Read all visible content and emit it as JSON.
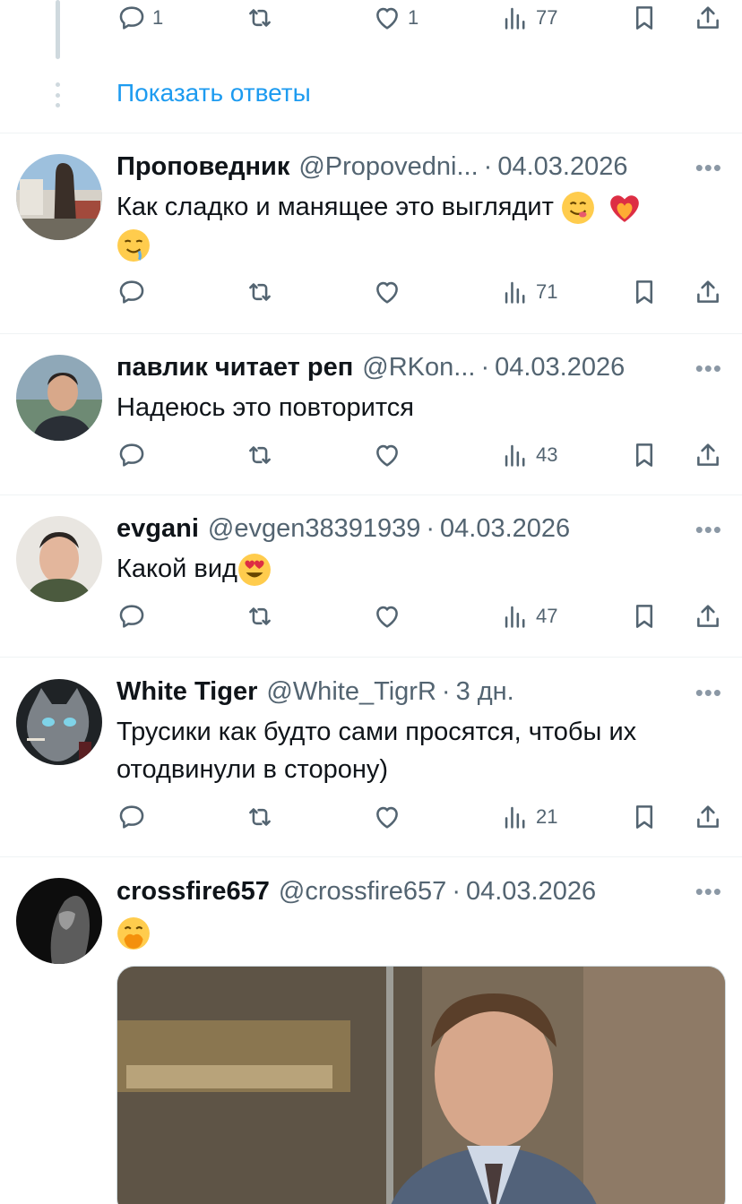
{
  "top_action_bar": {
    "reply_count": "1",
    "retweet_count": "",
    "like_count": "1",
    "views_count": "77"
  },
  "show_replies_label": "Показать ответы",
  "tweets": [
    {
      "name": "Проповедник",
      "handle": "@Propovedni...",
      "sep": "·",
      "date": "04.03.2026",
      "text": "Как сладко и манящее это выглядит",
      "views": "71"
    },
    {
      "name": "павлик читает реп",
      "handle": "@RKon...",
      "sep": "·",
      "date": "04.03.2026",
      "text": "Надеюсь это повторится",
      "views": "43"
    },
    {
      "name": "evgani",
      "handle": "@evgen38391939",
      "sep": "·",
      "date": "04.03.2026",
      "text": "Какой вид",
      "views": "47"
    },
    {
      "name": "White Tiger",
      "handle": "@White_TigrR",
      "sep": "·",
      "date": "3 дн.",
      "text": "Трусики как будто сами просятся, чтобы их отодвинули в сторону)",
      "views": "21"
    },
    {
      "name": "crossfire657",
      "handle": "@crossfire657",
      "sep": "·",
      "date": "04.03.2026",
      "text": ""
    }
  ],
  "icons": {
    "reply": "speech-bubble",
    "retweet": "retweet-arrows",
    "like": "heart",
    "views": "bar-chart",
    "bookmark": "bookmark",
    "share": "upload-arrow",
    "more": "ellipsis"
  },
  "colors": {
    "accent": "#1d9bf0",
    "text": "#0f1419",
    "secondary": "#536471",
    "divider": "#eff3f4"
  }
}
